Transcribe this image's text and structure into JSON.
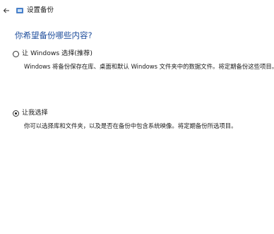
{
  "window": {
    "title": "设置备份"
  },
  "icons": {
    "back": "back-arrow-icon",
    "app": "backup-app-icon"
  },
  "colors": {
    "heading": "#1f4e9c",
    "app_icon_accent": "#3b7fd4"
  },
  "main": {
    "heading": "你希望备份哪些内容?",
    "options": [
      {
        "label": "让 Windows 选择(推荐)",
        "description": "Windows 将备份保存在库、桌面和默认 Windows 文件夹中的数据文件。将定期备份这些项目。",
        "selected": false
      },
      {
        "label": "让我选择",
        "description": "你可以选择库和文件夹，以及是否在备份中包含系统映像。将定期备份所选项目。",
        "selected": true
      }
    ]
  }
}
